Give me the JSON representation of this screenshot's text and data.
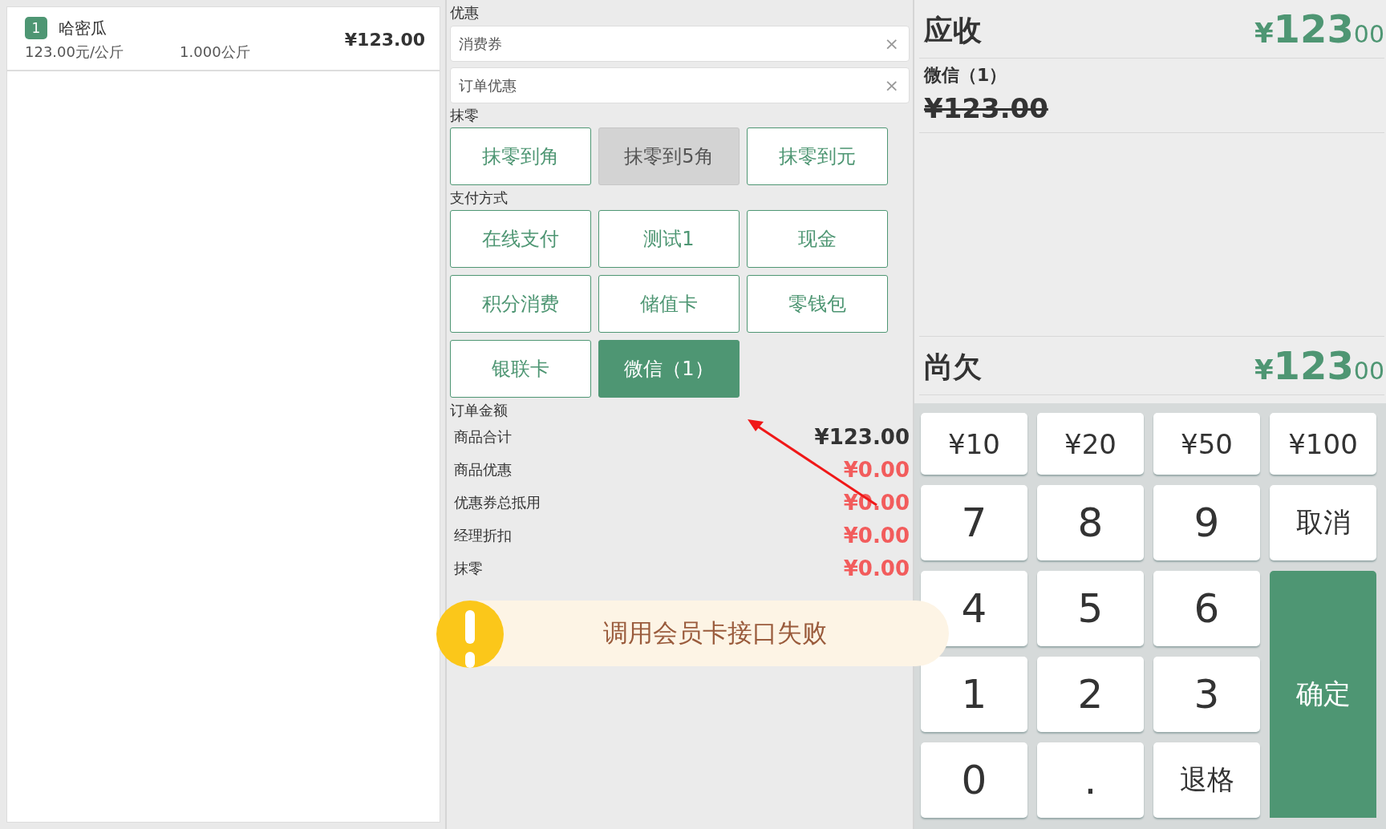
{
  "order_items": [
    {
      "index": "1",
      "name": "哈密瓜",
      "unit_price": "123.00元/公斤",
      "quantity": "1.000公斤",
      "total": "¥123.00"
    }
  ],
  "discount": {
    "label": "优惠",
    "fields": [
      {
        "placeholder": "消费券",
        "clear": "×"
      },
      {
        "placeholder": "订单优惠",
        "clear": "×"
      }
    ]
  },
  "rounding": {
    "label": "抹零",
    "options": [
      {
        "label": "抹零到角",
        "selected": false
      },
      {
        "label": "抹零到5角",
        "selected": true
      },
      {
        "label": "抹零到元",
        "selected": false
      }
    ]
  },
  "payment_methods": {
    "label": "支付方式",
    "options": [
      {
        "label": "在线支付",
        "selected": false
      },
      {
        "label": "测试1",
        "selected": false
      },
      {
        "label": "现金",
        "selected": false
      },
      {
        "label": "积分消费",
        "selected": false
      },
      {
        "label": "储值卡",
        "selected": false
      },
      {
        "label": "零钱包",
        "selected": false
      },
      {
        "label": "银联卡",
        "selected": false
      },
      {
        "label": "微信（1）",
        "selected": true
      }
    ]
  },
  "order_amount": {
    "label": "订单金额",
    "rows": [
      {
        "label": "商品合计",
        "value": "¥123.00",
        "color": "#333333"
      },
      {
        "label": "商品优惠",
        "value": "¥0.00",
        "color": "#f25c5c"
      },
      {
        "label": "优惠券总抵用",
        "value": "¥0.00",
        "color": "#f25c5c"
      },
      {
        "label": "经理折扣",
        "value": "¥0.00",
        "color": "#f25c5c"
      },
      {
        "label": "抹零",
        "value": "¥0.00",
        "color": "#f25c5c"
      }
    ]
  },
  "toast": {
    "message": "调用会员卡接口失败"
  },
  "receivable": {
    "label": "应收",
    "currency": "¥",
    "integer": "123",
    "decimal": "00"
  },
  "payments": [
    {
      "method": "微信（1）",
      "amount": "¥123.00"
    }
  ],
  "outstanding": {
    "label": "尚欠",
    "currency": "¥",
    "integer": "123",
    "decimal": "00"
  },
  "keypad": {
    "keys": [
      "¥10",
      "¥20",
      "¥50",
      "¥100",
      "7",
      "8",
      "9",
      "取消",
      "4",
      "5",
      "6",
      "1",
      "2",
      "3",
      "0",
      ".",
      "退格"
    ],
    "confirm": "确定"
  }
}
